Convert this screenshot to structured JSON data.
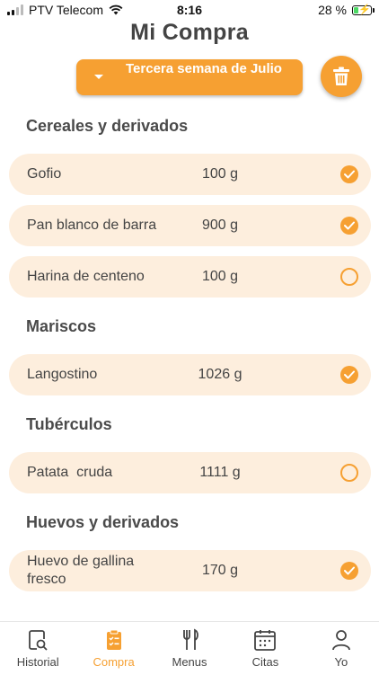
{
  "status_bar": {
    "carrier": "PTV Telecom",
    "time": "8:16",
    "battery_percent": "28 %",
    "battery_level": 0.28
  },
  "header": {
    "title": "Mi Compra"
  },
  "week_selector": {
    "label": "Tercera semana de Julio"
  },
  "colors": {
    "accent": "#f6a032",
    "item_background": "#fdeedd"
  },
  "sections": [
    {
      "title": "Cereales y derivados",
      "items": [
        {
          "name": "Gofio",
          "quantity": "100 g",
          "checked": true
        },
        {
          "name": "Pan blanco de barra",
          "quantity": "900 g",
          "checked": true
        },
        {
          "name": "Harina de centeno",
          "quantity": "100 g",
          "checked": false
        }
      ]
    },
    {
      "title": "Mariscos",
      "items": [
        {
          "name": "Langostino",
          "quantity": "1026 g",
          "checked": true
        }
      ]
    },
    {
      "title": "Tubérculos",
      "items": [
        {
          "name": "Patata  cruda",
          "quantity": "1111 g",
          "checked": false
        }
      ]
    },
    {
      "title": "Huevos y derivados",
      "items": [
        {
          "name": "Huevo de gallina fresco",
          "quantity": "170 g",
          "checked": true
        }
      ]
    }
  ],
  "tab_bar": {
    "tabs": [
      {
        "label": "Historial",
        "icon": "history-search-icon",
        "active": false
      },
      {
        "label": "Compra",
        "icon": "clipboard-list-icon",
        "active": true
      },
      {
        "label": "Menus",
        "icon": "fork-knife-icon",
        "active": false
      },
      {
        "label": "Citas",
        "icon": "calendar-icon",
        "active": false
      },
      {
        "label": "Yo",
        "icon": "user-icon",
        "active": false
      }
    ]
  }
}
